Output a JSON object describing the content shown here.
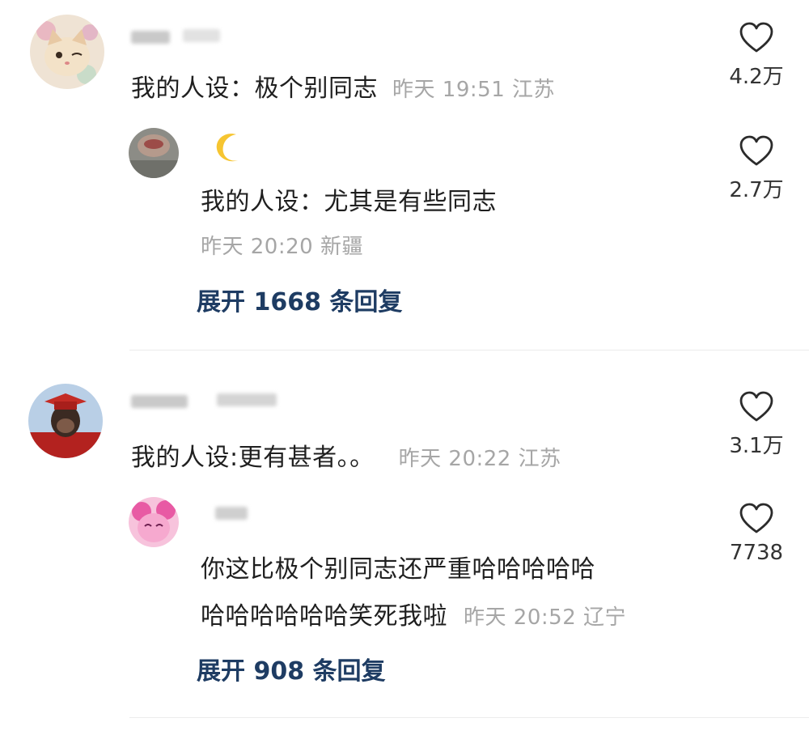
{
  "comments": [
    {
      "text": "我的人设：极个别同志",
      "meta": "昨天 19:51 江苏",
      "likes": "4.2万",
      "reply": {
        "username": "🌙",
        "text": "我的人设：尤其是有些同志",
        "meta": "昨天 20:20 新疆",
        "likes": "2.7万"
      },
      "expand_label": "展开 1668 条回复"
    },
    {
      "text": "我的人设:更有甚者。。",
      "meta": "昨天 20:22 江苏",
      "likes": "3.1万",
      "reply": {
        "text_line1": "你这比极个别同志还严重哈哈哈哈哈",
        "text_line2": "哈哈哈哈哈哈笑死我啦",
        "meta": "昨天 20:52 辽宁",
        "likes": "7738"
      },
      "expand_label": "展开 908 条回复"
    }
  ],
  "icons": {
    "like": "heart-outline-icon",
    "moon": "crescent-moon"
  },
  "colors": {
    "meta": "#a6a6a6",
    "expand": "#1e3c63"
  }
}
